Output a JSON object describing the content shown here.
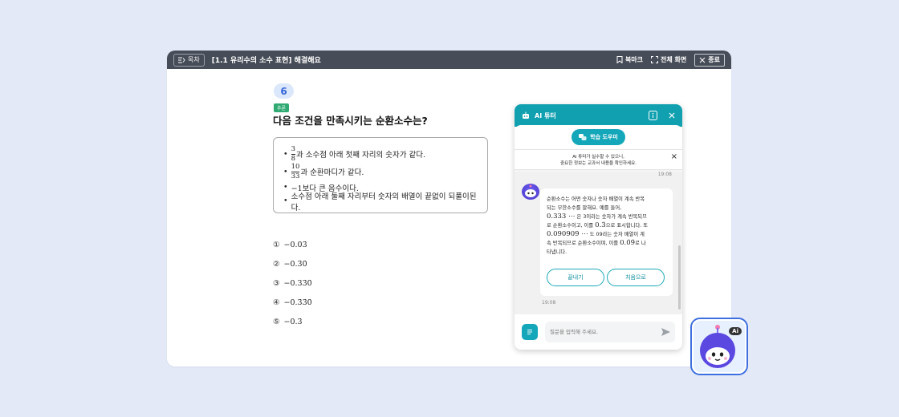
{
  "titlebar": {
    "toc_label": "목차",
    "title": "[1.1 유리수의 소수 표현] 해결해요",
    "bookmark_label": "북마크",
    "fullscreen_label": "전체 화면",
    "close_label": "종료"
  },
  "question": {
    "number": "6",
    "badge": "추론",
    "text": "다음 조건을 만족시키는 순환소수는?",
    "conditions": [
      {
        "frac_num": "3",
        "frac_den": "8",
        "text": "과 소수점 아래 첫째 자리의 숫자가 같다."
      },
      {
        "frac_num": "10",
        "frac_den": "33",
        "text": "과 순환마디가 같다."
      },
      {
        "text": "−1보다 큰 음수이다."
      },
      {
        "text": "소수점 아래 둘째 자리부터 숫자의 배열이 끝없이 되풀이된다."
      }
    ],
    "choices": [
      {
        "num": "①",
        "text": "−0.03̇"
      },
      {
        "num": "②",
        "text": "−0.3̇0̇"
      },
      {
        "num": "③",
        "text": "−0.33̇0̇"
      },
      {
        "num": "④",
        "text": "−0.3̇3̇0̇"
      },
      {
        "num": "⑤",
        "text": "−0.3̇"
      }
    ]
  },
  "chat": {
    "title": "AI 튜터",
    "tab_label": "학습 도우미",
    "notice_line1": "AI 튜터가 실수할 수 있으니,",
    "notice_line2": "중요한 정보는 교과서 내용을 확인하세요.",
    "time1": "19:08",
    "message": {
      "l1": "순환소수는 어떤 숫자나 숫자 배열이 계속 반복",
      "l2": "되는 무한소수를 말해요. 예를 들어,",
      "l3_math": "0.333 ⋯",
      "l3_text": " 은 3이라는 숫자가 계속 반복되므",
      "l4_text": "로 순환소수이고, 이를 ",
      "l4_math": "0.3̇",
      "l4_text2": "으로 표시합니다. 또",
      "l5_math": "0.090909 ⋯",
      "l5_text": " 도 09라는 숫자 배열이 계",
      "l6_text": "속 반복되므로 순환소수이며, 이를 ",
      "l6_math": "0.0̇9̇",
      "l6_text2": "로 나",
      "l7": "타냅니다."
    },
    "end_button": "끝내기",
    "restart_button": "처음으로",
    "time2": "19:08",
    "input_placeholder": "질문을 입력해 주세요."
  },
  "fab": {
    "tag": "Ai"
  },
  "colors": {
    "teal": "#10a0b0",
    "titlebar": "#474d58",
    "badge": "#2faa73",
    "fab_border": "#3d6fe0"
  }
}
